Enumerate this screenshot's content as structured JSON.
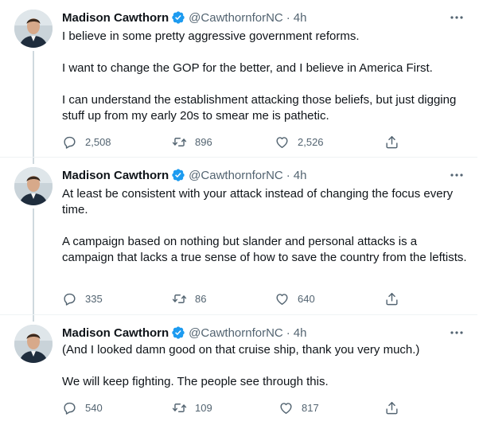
{
  "colors": {
    "verified": "#1d9bf0",
    "muted": "#536471",
    "text": "#0f1419",
    "thread_line": "#cfd9de"
  },
  "tweets": [
    {
      "name": "Madison Cawthorn",
      "handle": "@CawthornforNC",
      "time": "4h",
      "paragraphs": [
        "I believe in some pretty aggressive government reforms.",
        "I want to change the GOP for the better, and I believe in America First.",
        "I can understand the establishment attacking those beliefs, but just digging stuff up from my early 20s to smear me is pathetic."
      ],
      "replies": "2,508",
      "retweets": "896",
      "likes": "2,526"
    },
    {
      "name": "Madison Cawthorn",
      "handle": "@CawthornforNC",
      "time": "4h",
      "paragraphs": [
        "At least be consistent with your attack instead of changing the focus every time.",
        "A campaign based on nothing but slander and personal attacks is a campaign that lacks a true sense of how to save the country from the leftists."
      ],
      "replies": "335",
      "retweets": "86",
      "likes": "640"
    },
    {
      "name": "Madison Cawthorn",
      "handle": "@CawthornforNC",
      "time": "4h",
      "paragraphs": [
        "(And I looked damn good on that cruise ship, thank you very much.)",
        "We will keep fighting. The people see through this."
      ],
      "replies": "540",
      "retweets": "109",
      "likes": "817"
    }
  ],
  "separator": "·",
  "icons": [
    "verified-badge-icon",
    "more-options-icon",
    "reply-icon",
    "retweet-icon",
    "like-icon",
    "share-icon"
  ]
}
